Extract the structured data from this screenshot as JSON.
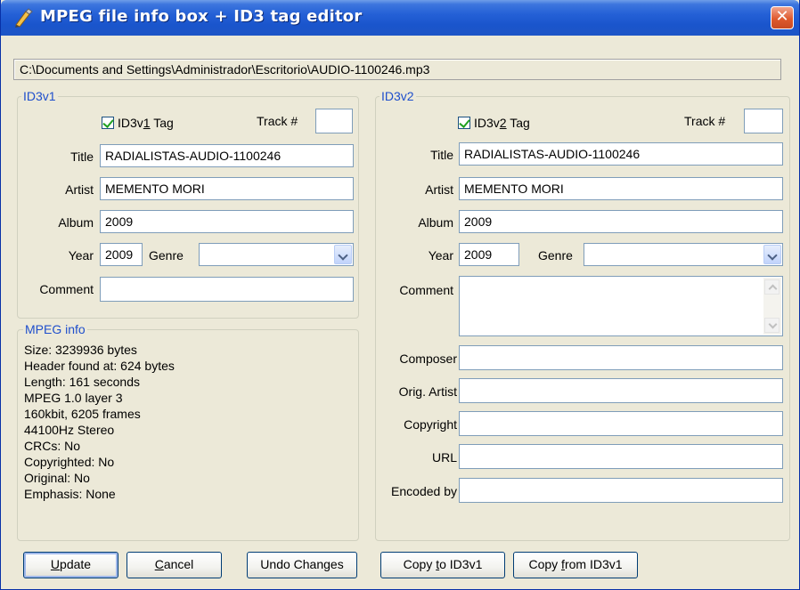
{
  "window": {
    "title": "MPEG file info box + ID3 tag editor",
    "close_label": "✕"
  },
  "file_path": "C:\\Documents and Settings\\Administrador\\Escritorio\\AUDIO-1100246.mp3",
  "id3v1": {
    "legend": "ID3v1",
    "tag_checkbox": {
      "prefix": "ID3v",
      "underlined": "1",
      "suffix": " Tag",
      "checked": true
    },
    "track_label": "Track #",
    "track_value": "",
    "title_label": "Title",
    "title_value": "RADIALISTAS-AUDIO-1100246",
    "artist_label": "Artist",
    "artist_value": "MEMENTO MORI",
    "album_label": "Album",
    "album_value": "2009",
    "year_label": "Year",
    "year_value": "2009",
    "genre_label": "Genre",
    "genre_value": "",
    "comment_label": "Comment",
    "comment_value": ""
  },
  "mpeg_info": {
    "legend": "MPEG info",
    "lines": [
      "Size: 3239936 bytes",
      "Header found at: 624 bytes",
      "Length: 161 seconds",
      "MPEG 1.0 layer 3",
      "160kbit, 6205 frames",
      "44100Hz Stereo",
      "CRCs: No",
      "Copyrighted: No",
      "Original: No",
      "Emphasis: None"
    ]
  },
  "id3v2": {
    "legend": "ID3v2",
    "tag_checkbox": {
      "prefix": "ID3v",
      "underlined": "2",
      "suffix": " Tag",
      "checked": true
    },
    "track_label": "Track #",
    "track_value": "",
    "title_label": "Title",
    "title_value": "RADIALISTAS-AUDIO-1100246",
    "artist_label": "Artist",
    "artist_value": "MEMENTO MORI",
    "album_label": "Album",
    "album_value": "2009",
    "year_label": "Year",
    "year_value": "2009",
    "genre_label": "Genre",
    "genre_value": "",
    "comment_label": "Comment",
    "comment_value": "",
    "composer_label": "Composer",
    "composer_value": "",
    "orig_artist_label": "Orig. Artist",
    "orig_artist_value": "",
    "copyright_label": "Copyright",
    "copyright_value": "",
    "url_label": "URL",
    "url_value": "",
    "encoded_by_label": "Encoded by",
    "encoded_by_value": ""
  },
  "buttons": {
    "update": {
      "accel": "U",
      "rest": "pdate"
    },
    "cancel": {
      "accel": "C",
      "rest": "ancel"
    },
    "undo": "Undo Changes",
    "copy_to": {
      "pre": "Copy ",
      "accel": "t",
      "rest": "o ID3v1"
    },
    "copy_from": {
      "pre": "Copy ",
      "accel": "f",
      "rest": "rom ID3v1"
    }
  },
  "colors": {
    "titlebar": "#2460d6",
    "window_bg": "#ece9d8",
    "group_legend": "#1f4fcc",
    "close_button": "#df5a2e"
  }
}
